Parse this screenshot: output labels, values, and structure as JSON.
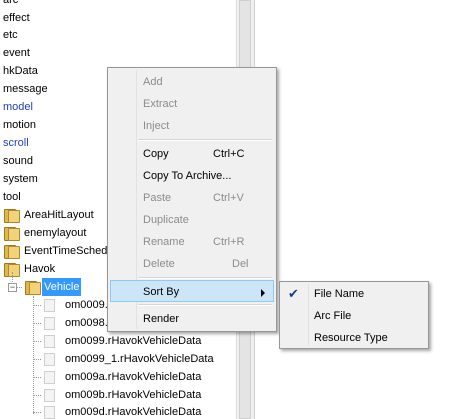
{
  "tree": {
    "top_items": [
      {
        "label": "arc",
        "blue": false
      },
      {
        "label": "effect",
        "blue": false
      },
      {
        "label": "etc",
        "blue": false
      },
      {
        "label": "event",
        "blue": false
      },
      {
        "label": "hkData",
        "blue": false
      },
      {
        "label": "message",
        "blue": false
      },
      {
        "label": "model",
        "blue": true
      },
      {
        "label": "motion",
        "blue": false
      },
      {
        "label": "scroll",
        "blue": true
      },
      {
        "label": "sound",
        "blue": false
      },
      {
        "label": "system",
        "blue": false
      },
      {
        "label": "tool",
        "blue": false
      }
    ],
    "folders": [
      "AreaHitLayout",
      "enemylayout",
      "EventTimeSched",
      "Havok"
    ],
    "expanded_folder": "Vehicle",
    "files": [
      "om0009.",
      "om0098.",
      "om0099.rHavokVehicleData",
      "om0099_1.rHavokVehicleData",
      "om009a.rHavokVehicleData",
      "om009b.rHavokVehicleData",
      "om009d.rHavokVehicleData"
    ],
    "expander_symbol": "−"
  },
  "context_menu": {
    "items": [
      {
        "label": "Add",
        "shortcut": "",
        "disabled": true
      },
      {
        "label": "Extract",
        "shortcut": "",
        "disabled": true
      },
      {
        "label": "Inject",
        "shortcut": "",
        "disabled": true
      },
      {
        "label": "Copy",
        "shortcut": "Ctrl+C",
        "disabled": false
      },
      {
        "label": "Copy To Archive...",
        "shortcut": "",
        "disabled": false
      },
      {
        "label": "Paste",
        "shortcut": "Ctrl+V",
        "disabled": true
      },
      {
        "label": "Duplicate",
        "shortcut": "",
        "disabled": true
      },
      {
        "label": "Rename",
        "shortcut": "Ctrl+R",
        "disabled": true
      },
      {
        "label": "Delete",
        "shortcut": "Del",
        "disabled": true
      },
      {
        "label": "Sort By",
        "shortcut": "",
        "disabled": false,
        "has_submenu": true
      },
      {
        "label": "Render",
        "shortcut": "",
        "disabled": false
      }
    ]
  },
  "submenu": {
    "items": [
      {
        "label": "File Name",
        "checked": true
      },
      {
        "label": "Arc File",
        "checked": false
      },
      {
        "label": "Resource Type",
        "checked": false
      }
    ],
    "check_glyph": "✔"
  },
  "colors": {
    "selection": "#3399ff",
    "menu_hover": "#cde6f7",
    "blue_text": "#1f3fbf"
  }
}
